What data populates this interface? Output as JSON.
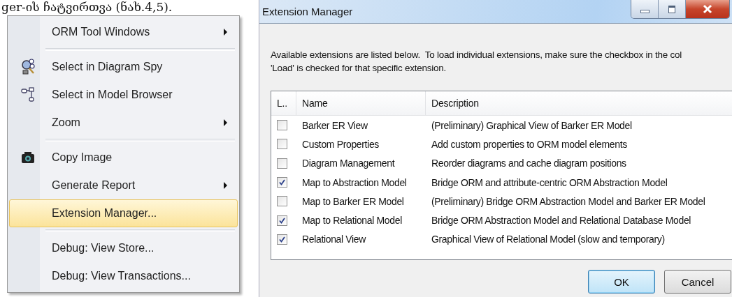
{
  "document_text": "ger-ის ჩატვირთვა (ნახ.4,5).",
  "context_menu": {
    "items": [
      {
        "kind": "item",
        "label": "ORM Tool Windows",
        "submenu": true,
        "selected": false
      },
      {
        "kind": "separator"
      },
      {
        "kind": "item",
        "label": "Select in Diagram Spy",
        "submenu": false,
        "selected": false
      },
      {
        "kind": "item",
        "label": "Select in Model Browser",
        "submenu": false,
        "selected": false
      },
      {
        "kind": "item",
        "label": "Zoom",
        "submenu": true,
        "selected": false
      },
      {
        "kind": "separator"
      },
      {
        "kind": "item",
        "label": "Copy Image",
        "submenu": false,
        "selected": false
      },
      {
        "kind": "item",
        "label": "Generate Report",
        "submenu": true,
        "selected": false
      },
      {
        "kind": "item",
        "label": "Extension Manager...",
        "submenu": false,
        "selected": true
      },
      {
        "kind": "separator"
      },
      {
        "kind": "item",
        "label": "Debug: View Store...",
        "submenu": false,
        "selected": false
      },
      {
        "kind": "item",
        "label": "Debug: View Transactions...",
        "submenu": false,
        "selected": false
      }
    ]
  },
  "window": {
    "title": "Extension Manager",
    "intro_lines": [
      "Available extensions are listed below.  To load individual extensions, make sure the checkbox in the col",
      "'Load' is checked for that specific extension."
    ],
    "table": {
      "columns": [
        "L..",
        "Name",
        "Description"
      ],
      "rows": [
        {
          "checked": false,
          "name": "Barker ER View",
          "description": "(Preliminary) Graphical View of Barker ER Model"
        },
        {
          "checked": false,
          "name": "Custom Properties",
          "description": "Add custom properties to ORM model elements"
        },
        {
          "checked": false,
          "name": "Diagram Management",
          "description": "Reorder diagrams and cache diagram positions"
        },
        {
          "checked": true,
          "name": "Map to Abstraction Model",
          "description": "Bridge ORM and attribute-centric ORM Abstraction Model"
        },
        {
          "checked": false,
          "name": "Map to Barker ER Model",
          "description": "(Preliminary) Bridge ORM Abstraction Model and Barker ER Model"
        },
        {
          "checked": true,
          "name": "Map to Relational Model",
          "description": "Bridge ORM Abstraction Model and Relational Database Model"
        },
        {
          "checked": true,
          "name": "Relational View",
          "description": "Graphical View of Relational Model (slow and temporary)"
        }
      ]
    },
    "buttons": [
      "OK",
      "Cancel"
    ]
  }
}
